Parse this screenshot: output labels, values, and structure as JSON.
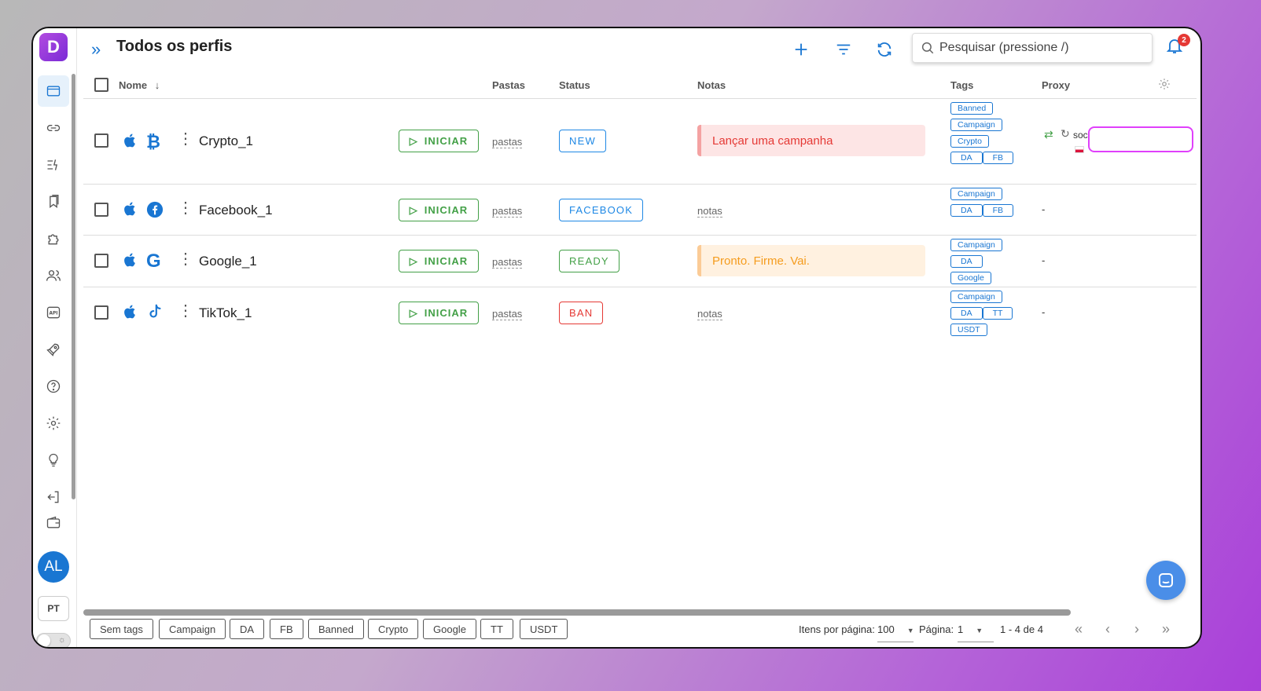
{
  "app": {
    "logo_letter": "D",
    "page_title": "Todos os perfis",
    "brand_color": "#1976d2",
    "accent_purple": "#9b3ee0"
  },
  "header": {
    "search_placeholder": "Pesquisar (pressione /)",
    "notification_count": "2",
    "add_icon": "plus-icon",
    "filter_icon": "filter-icon",
    "refresh_icon": "refresh-icon"
  },
  "sidebar": {
    "items": [
      {
        "icon": "browser-window-icon",
        "active": true
      },
      {
        "icon": "link-icon"
      },
      {
        "icon": "automation-icon"
      },
      {
        "icon": "bookmarks-icon"
      },
      {
        "icon": "extension-puzzle-icon"
      },
      {
        "icon": "team-users-icon"
      },
      {
        "icon": "api-icon"
      },
      {
        "icon": "rocket-icon"
      },
      {
        "icon": "help-circle-icon"
      },
      {
        "icon": "settings-gear-icon"
      },
      {
        "icon": "lightbulb-icon"
      },
      {
        "icon": "logout-icon"
      },
      {
        "icon": "wallet-icon"
      }
    ],
    "avatar_initials": "AL",
    "language": "PT"
  },
  "table": {
    "columns": {
      "name": "Nome",
      "folders": "Pastas",
      "status": "Status",
      "notes": "Notas",
      "tags": "Tags",
      "proxy": "Proxy"
    },
    "start_label": "INICIAR",
    "folders_placeholder": "pastas",
    "notes_placeholder": "notas",
    "rows": [
      {
        "name": "Crypto_1",
        "platform_icon": "bitcoin-icon",
        "status": "NEW",
        "status_color": "#1e88e5",
        "note": "Lançar uma campanha",
        "note_style": "red",
        "tags": [
          [
            "Banned"
          ],
          [
            "Campaign"
          ],
          [
            "Crypto"
          ],
          [
            "DA",
            "FB"
          ]
        ],
        "proxy": "soc"
      },
      {
        "name": "Facebook_1",
        "platform_icon": "facebook-icon",
        "status": "FACEBOOK",
        "status_color": "#1e88e5",
        "note": "",
        "tags": [
          [
            "Campaign"
          ],
          [
            "DA",
            "FB"
          ]
        ],
        "proxy": "-"
      },
      {
        "name": "Google_1",
        "platform_icon": "google-icon",
        "status": "READY",
        "status_color": "#43a047",
        "note": "Pronto. Firme. Vai.",
        "note_style": "orange",
        "tags": [
          [
            "Campaign"
          ],
          [
            "DA"
          ],
          [
            "Google"
          ]
        ],
        "proxy": "-"
      },
      {
        "name": "TikTok_1",
        "platform_icon": "tiktok-icon",
        "status": "BAN",
        "status_color": "#e53935",
        "note": "",
        "tags": [
          [
            "Campaign"
          ],
          [
            "DA",
            "TT"
          ],
          [
            "USDT"
          ]
        ],
        "proxy": "-"
      }
    ]
  },
  "footer": {
    "tag_filters": [
      "Sem tags",
      "Campaign",
      "DA",
      "FB",
      "Banned",
      "Crypto",
      "Google",
      "TT",
      "USDT"
    ],
    "items_per_page_label": "Itens por página:",
    "items_per_page": "100",
    "page_label": "Página:",
    "page": "1",
    "range": "1 - 4 de 4"
  }
}
